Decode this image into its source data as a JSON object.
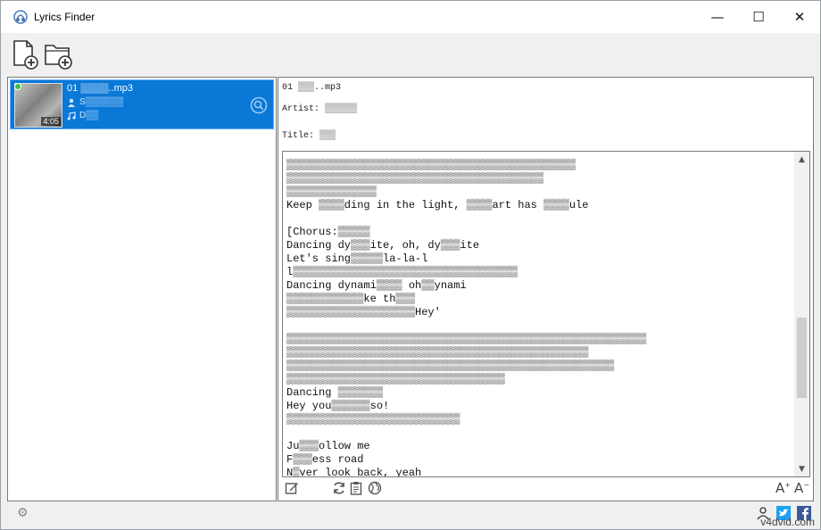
{
  "window": {
    "title": "Lyrics Finder",
    "controls": {
      "minimize": "—",
      "maximize": "☐",
      "close": "✕"
    }
  },
  "toolbar": {
    "buttons": [
      {
        "name": "add-file",
        "icon": "file-add-icon"
      },
      {
        "name": "add-folder",
        "icon": "folder-add-icon"
      }
    ]
  },
  "track_list": [
    {
      "file": "01 ▒▒▒▒..mp3",
      "artist": "S▒▒▒▒▒▒",
      "title": "D▒▒",
      "duration": "4:05",
      "selected": true,
      "has_lyrics": true
    }
  ],
  "details": {
    "file": "01 ▒▒▒..mp3",
    "artist_label": "Artist:",
    "artist_value": "▒▒▒▒▒▒",
    "title_label": "Title:",
    "title_value": "▒▒▒"
  },
  "lyrics": [
    "▒▒▒▒▒▒▒▒▒▒▒▒▒▒▒▒▒▒▒▒▒▒▒▒▒▒▒▒▒▒▒▒▒▒▒▒▒▒▒▒▒▒▒▒▒",
    "▒▒▒▒▒▒▒▒▒▒▒▒▒▒▒▒▒▒▒▒▒▒▒▒▒▒▒▒▒▒▒▒▒▒▒▒▒▒▒▒",
    "▒▒▒▒▒▒▒▒▒▒▒▒▒▒",
    "Keep ▒▒▒▒ding in the light, ▒▒▒▒art has ▒▒▒▒ule",
    "",
    "[Chorus:▒▒▒▒▒",
    "Dancing dy▒▒▒ite, oh, dy▒▒▒ite",
    "Let's sing▒▒▒▒▒la-la-l",
    "l▒▒▒▒▒▒▒▒▒▒▒▒▒▒▒▒▒▒▒▒▒▒▒▒▒▒▒▒▒▒▒▒▒▒▒",
    "Dancing dynami▒▒▒▒ oh▒▒ynami",
    "▒▒▒▒▒▒▒▒▒▒▒▒ke th▒▒▒",
    "▒▒▒▒▒▒▒▒▒▒▒▒▒▒▒▒▒▒▒▒Hey'",
    "",
    "▒▒▒▒▒▒▒▒▒▒▒▒▒▒▒▒▒▒▒▒▒▒▒▒▒▒▒▒▒▒▒▒▒▒▒▒▒▒▒▒▒▒▒▒▒▒▒▒▒▒▒▒▒▒▒▒",
    "▒▒▒▒▒▒▒▒▒▒▒▒▒▒▒▒▒▒▒▒▒▒▒▒▒▒▒▒▒▒▒▒▒▒▒▒▒▒▒▒▒▒▒▒▒▒▒",
    "▒▒▒▒▒▒▒▒▒▒▒▒▒▒▒▒▒▒▒▒▒▒▒▒▒▒▒▒▒▒▒▒▒▒▒▒▒▒▒▒▒▒▒▒▒▒▒▒▒▒▒",
    "▒▒▒▒▒▒▒▒▒▒▒▒▒▒▒▒▒▒▒▒▒▒▒▒▒▒▒▒▒▒▒▒▒▒",
    "Dancing ▒▒▒▒▒▒▒",
    "Hey you▒▒▒▒▒▒so!",
    "▒▒▒▒▒▒▒▒▒▒▒▒▒▒▒▒▒▒▒▒▒▒▒▒▒▒▒",
    "",
    "Ju▒▒▒ollow me",
    "F▒▒▒ess road",
    "N▒ver look back, yeah"
  ],
  "edit_bar": {
    "icons": [
      "edit-icon",
      "refresh-icon",
      "clipboard-icon",
      "globe-icon"
    ],
    "font_increase": "A",
    "font_decrease": "A",
    "font_increase_mark": "+",
    "font_decrease_mark": "−"
  },
  "status_bar": {
    "settings_icon": "gear-icon",
    "icons": [
      "user-icon",
      "twitter-icon",
      "facebook-icon"
    ],
    "watermark": "v4dvid.com"
  },
  "colors": {
    "selection": "#0a78d7",
    "twitter": "#1da1f2",
    "facebook": "#3b5998"
  }
}
